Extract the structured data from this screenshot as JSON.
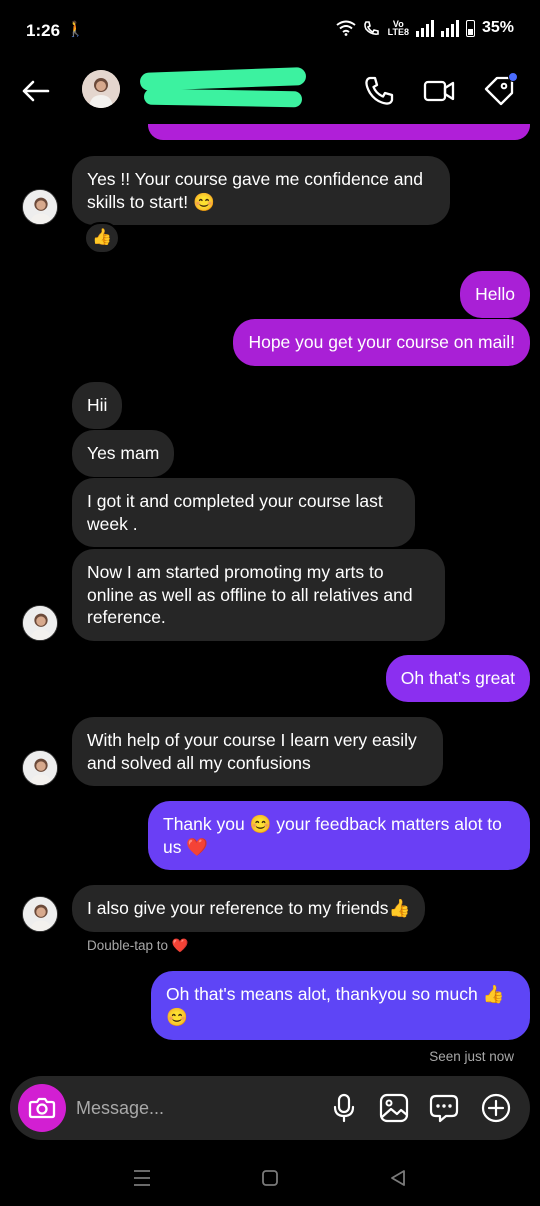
{
  "status_bar": {
    "time": "1:26",
    "battery": "35%",
    "volte_top": "Vo",
    "volte_bottom": "LTE8"
  },
  "header": {
    "contact_name": "",
    "back_icon": "arrow-left-icon",
    "call_icon": "phone-icon",
    "video_icon": "video-camera-icon",
    "tag_icon": "tag-icon"
  },
  "messages": [
    {
      "id": "m1",
      "direction": "incoming",
      "text": "Yes !! Your course gave me confidence and skills to start! 😊",
      "reaction": "👍"
    },
    {
      "id": "m2",
      "direction": "outgoing",
      "text": "Hello"
    },
    {
      "id": "m3",
      "direction": "outgoing",
      "text": "Hope you get your course on mail!"
    },
    {
      "id": "m4",
      "direction": "incoming",
      "text": "Hii"
    },
    {
      "id": "m5",
      "direction": "incoming",
      "text": "Yes mam"
    },
    {
      "id": "m6",
      "direction": "incoming",
      "text": "I got it and completed your course last week ."
    },
    {
      "id": "m7",
      "direction": "incoming",
      "text": "Now I am started promoting my arts to online as well as offline to all relatives and reference."
    },
    {
      "id": "m8",
      "direction": "outgoing",
      "text": "Oh that's great"
    },
    {
      "id": "m9",
      "direction": "incoming",
      "text": "With help of your course I learn very easily and solved all my confusions"
    },
    {
      "id": "m10",
      "direction": "outgoing",
      "text": "Thank you 😊 your feedback matters alot to us ❤️"
    },
    {
      "id": "m11",
      "direction": "incoming",
      "text": "I also give your reference to my friends👍"
    },
    {
      "id": "m12",
      "direction": "outgoing",
      "text": "Oh that's means alot, thankyou so much 👍 😊"
    }
  ],
  "hint_text": "Double-tap to ❤️",
  "seen_text": "Seen just now",
  "composer": {
    "placeholder": "Message...",
    "camera_icon": "camera-icon",
    "mic_icon": "microphone-icon",
    "gallery_icon": "image-icon",
    "sticker_icon": "chat-bubble-icon",
    "add_icon": "plus-circle-icon"
  },
  "colors": {
    "background": "#000000",
    "incoming_bubble": "#262626",
    "outgoing_magenta": "#a920d6",
    "outgoing_violet": "#6a3ff5",
    "camera_button": "#d21fd2",
    "redaction": "#3cf2a0"
  }
}
